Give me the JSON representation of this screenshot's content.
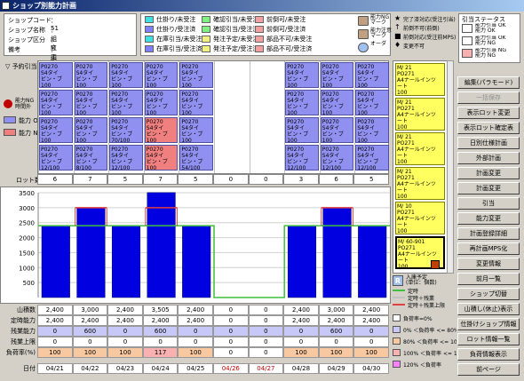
{
  "window": {
    "title": "ショップ別能力計画"
  },
  "info": [
    {
      "label": "ショップコード",
      "value": "：51"
    },
    {
      "label": "ショップ名称",
      "value": "：組立工場"
    },
    {
      "label": "ショップ区分",
      "value": "：M"
    },
    {
      "label": "備考",
      "value": "：組立工場"
    }
  ],
  "legend": [
    {
      "label": "仕掛り/未受注",
      "color": "#40e0e0"
    },
    {
      "label": "仕掛り/受注済",
      "color": "#8080ff"
    },
    {
      "label": "在庫引当/未受注",
      "color": "#40e0e0"
    },
    {
      "label": "在庫引当/受注済",
      "color": "#8080ff"
    },
    {
      "label": "確認引当/未受注",
      "color": "#80f080"
    },
    {
      "label": "確認引当/受注済",
      "color": "#80f080"
    },
    {
      "label": "発注予定/未受注",
      "color": "#f0f080"
    },
    {
      "label": "発注予定/受注済",
      "color": "#f0f080"
    },
    {
      "label": "前倒可/未受注",
      "color": "#f0a0a0"
    },
    {
      "label": "前倒可/受注済",
      "color": "#f0a0a0"
    },
    {
      "label": "部品不可/未受注",
      "color": "#f0a0a0"
    },
    {
      "label": "部品不可/受注済",
      "color": "#f0a0a0"
    },
    {
      "label": "能力NG\nマーク",
      "color": "#c0a080"
    },
    {
      "label": "能力注意\nマーク",
      "color": "#c0a080"
    },
    {
      "label": "オーダ",
      "color": "#a0c0f0"
    }
  ],
  "legend_marks": [
    {
      "label": "完了済対応(受注引当)"
    },
    {
      "label": "前倒不可(前倒)"
    },
    {
      "label": "前倒対応(受注前MPS)"
    },
    {
      "label": "変更不可"
    }
  ],
  "status": {
    "title": "引当ステータス",
    "items": [
      {
        "label": "能力引当 OK\n能力 OK"
      },
      {
        "label": "能力引当 OK\n能力 NG"
      },
      {
        "label": "能力引当 NG\n能力 NG"
      }
    ]
  },
  "left_labels": {
    "stock": "▽ 予約引当",
    "red_label": "能力NG\n時間外",
    "ng_label": "能力 OK",
    "ng2_label": "能力 NG"
  },
  "orders": {
    "cols": [
      [
        {
          "t": "P0270\nS4タイ\nビン・ブ\n100"
        },
        {
          "t": "P0270\nS4タイ\nビン・ブ\n100"
        },
        {
          "t": "P0270\nS4タイ\nビン・ブ\n100"
        },
        {
          "t": "P0270\nS4タイ\nビン・ブ\n12/100"
        }
      ],
      [
        {
          "t": "P0270\nS4タイ\nビン・ブ\n100"
        },
        {
          "t": "P0270\nS4タイ\nビン・ブ\n100"
        },
        {
          "t": "P0270\nS4タイ\nビン・ブ\n100"
        },
        {
          "t": "P0270\nS4タイ\nビン・ブ\n8/100"
        }
      ],
      [
        {
          "t": "P0270\nS4タイ\nビン・ブ\n100"
        },
        {
          "t": "P0270\nS4タイ\nビン・ブ\n100"
        },
        {
          "t": "P0270\nS4タイ\nビン・ブ\n70/100"
        },
        {
          "t": "P0270\nS4タイ\nビン・ブ\n12/100"
        }
      ],
      [
        {
          "t": "P0270\nS4タイ\nビン・ブ\n100"
        },
        {
          "t": "P0270\nS4タイ\nビン・ブ\n100"
        },
        {
          "t": "P0270\nS4タイ\nビン・ブ\n100",
          "pink": true
        },
        {
          "t": "P0270\nS4タイ\nビン・ブ\n100",
          "pink": true
        }
      ],
      [
        {
          "t": "P0270\nS4タイ\nビン・ブ\n100"
        },
        {
          "t": "P0270\nS4タイ\nビン・ブ\n100"
        },
        {
          "t": "P0270\nS4タイ\nビン・ブ\n100"
        },
        {
          "t": "P0270\nS4タイ\nビン・ブ\n54/100"
        }
      ],
      [],
      [],
      [
        {
          "t": "P0270\nS4タイ\nビン・ブ\n100"
        },
        {
          "t": "P0270\nS4タイ\nビン・ブ\n100"
        },
        {
          "t": "P0270\nS4タイ\nビン・ブ\n100"
        },
        {
          "t": "P0270\nS4タイ\nビン・ブ\n12/100"
        }
      ],
      [
        {
          "t": "P0270\nS4タイ\nビン・ブ\n100"
        },
        {
          "t": "P0270\nS4タイ\nビン・ブ\n100"
        },
        {
          "t": "P0270\nS4タイ\nビン・ブ\n100"
        },
        {
          "t": "P0270\nS4タイ\nビン・ブ\n12/100"
        }
      ],
      [
        {
          "t": "P0270\nS4タイ\nビン・ブ\n100"
        },
        {
          "t": "P0270\nS4タイ\nビン・ブ\n100"
        },
        {
          "t": "P0270\nS4タイ\nビン・ブ\n100"
        },
        {
          "t": "P0270\nS4タイ\nビン・ブ\n12/100"
        }
      ]
    ]
  },
  "lot_label": "ロット数",
  "lot_counts": [
    "6",
    "7",
    "5",
    "7",
    "5",
    "0",
    "0",
    "3",
    "6",
    "5"
  ],
  "yellow_cards": [
    {
      "t": "M/ 21\nPO271\nA4ナールインツ\nート\n100"
    },
    {
      "t": "M/ 21\nPO271\nA4ナールインツ\nート\n100"
    },
    {
      "t": "M/ 21\nPO271\nA4ナールインツ\nート\n100"
    },
    {
      "t": "M/ 21\nPO271\nA4ナールインツ\nート\n100"
    },
    {
      "t": "M/ 10\nPO271\nA4ナールインツ\nート\n100"
    },
    {
      "t": "M/ 60-901\nPO271\nA4ナールインツ\nート\n100",
      "sel": true
    }
  ],
  "buttons": [
    {
      "label": "編集(パラモード)"
    },
    {
      "label": "一括保存",
      "disabled": true
    },
    {
      "label": "表示ロット変更"
    },
    {
      "label": "表示ロット確定表"
    },
    {
      "label": "日別仕様計画"
    },
    {
      "label": "外部計画"
    },
    {
      "label": "計画変更"
    },
    {
      "label": "計画変更"
    },
    {
      "label": "引当"
    },
    {
      "label": "能力変更"
    },
    {
      "label": "計画登録詳細"
    },
    {
      "label": "再計画MPS化"
    },
    {
      "label": "変更情報"
    },
    {
      "label": "前月一覧"
    },
    {
      "label": "ショップ切替"
    },
    {
      "label": "山積し(休止)表示"
    },
    {
      "label": "仕掛けショップ情報"
    },
    {
      "label": "ロット情報一覧"
    },
    {
      "label": "負荷情報表示"
    },
    {
      "label": "前ページ"
    }
  ],
  "mini_legend": {
    "r": "R",
    "qty": "入庫予定\n(単位：個数)",
    "lines": [
      {
        "label": "定時",
        "color": "#40c040"
      },
      {
        "label": "定時＋残業",
        "color": "#c0c0c0"
      },
      {
        "label": "定時＋残業上限",
        "color": "#e04040"
      }
    ]
  },
  "load_legend": [
    {
      "label": "負荷率=0%",
      "color": "#ffffff"
    },
    {
      "label": "0% ＜負荷率 <= 80%",
      "color": "#c8c8f8"
    },
    {
      "label": "80% ＜負荷率 <= 100%",
      "color": "#f8c8a0"
    },
    {
      "label": "100% ＜負荷率 <= 120%",
      "color": "#f8b0b0"
    },
    {
      "label": "120% ＜負荷率",
      "color": "#ff80ff"
    }
  ],
  "chart_data": {
    "type": "bar",
    "categories": [
      "04/21",
      "04/22",
      "04/23",
      "04/24",
      "04/25",
      "04/26",
      "04/27",
      "04/28",
      "04/29",
      "04/30"
    ],
    "values": [
      2400,
      3000,
      2400,
      3505,
      2400,
      0,
      0,
      2400,
      3000,
      2400
    ],
    "teiji": [
      2400,
      2400,
      2400,
      2400,
      2400,
      0,
      0,
      2400,
      2400,
      2400
    ],
    "zangyo": [
      2400,
      3000,
      2400,
      3000,
      2400,
      0,
      0,
      2400,
      3000,
      2400
    ],
    "ylim": [
      0,
      3500
    ],
    "yticks": [
      500,
      1000,
      1500,
      2000,
      2500,
      3000,
      3500
    ],
    "bar_color": "#0000e0",
    "teiji_color": "#40c040",
    "zangyo_color": "#e04040"
  },
  "table": {
    "rows": [
      {
        "label": "山積数",
        "vals": [
          "2,400",
          "3,000",
          "2,400",
          "3,505",
          "2,400",
          "0",
          "0",
          "2,400",
          "3,000",
          "2,400"
        ],
        "style": "white"
      },
      {
        "label": "定時能力",
        "vals": [
          "2,400",
          "2,400",
          "2,400",
          "2,400",
          "2,400",
          "0",
          "0",
          "2,400",
          "2,400",
          "2,400"
        ],
        "style": "white"
      },
      {
        "label": "残業能力",
        "vals": [
          "0",
          "600",
          "0",
          "600",
          "0",
          "0",
          "0",
          "0",
          "600",
          "0"
        ],
        "style": "lav"
      },
      {
        "label": "残業上限",
        "vals": [
          "0",
          "0",
          "0",
          "0",
          "0",
          "0",
          "0",
          "0",
          "0",
          "0"
        ],
        "style": "white"
      },
      {
        "label": "負荷率(%)",
        "vals": [
          "100",
          "100",
          "100",
          "117",
          "100",
          "0",
          "0",
          "100",
          "100",
          "100"
        ],
        "style": "load"
      }
    ],
    "date_label": "日付",
    "dates": [
      "04/21",
      "04/22",
      "04/23",
      "04/24",
      "04/25",
      "04/26",
      "04/27",
      "04/28",
      "04/29",
      "04/30"
    ],
    "red_dates": [
      5,
      6
    ]
  }
}
